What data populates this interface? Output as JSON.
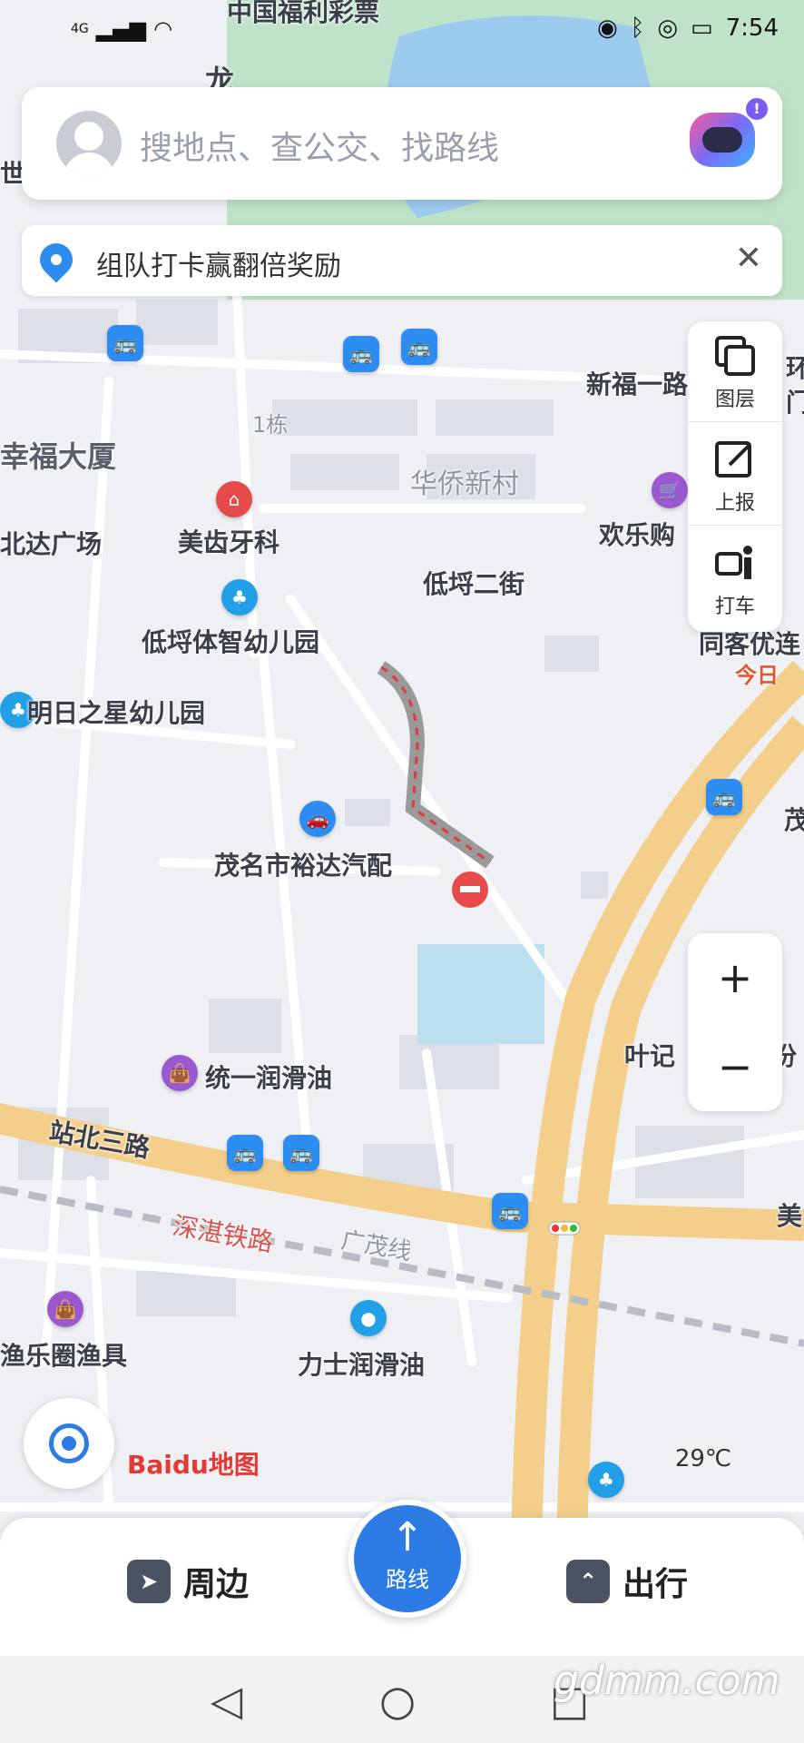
{
  "status": {
    "network": "4G",
    "time": "7:54"
  },
  "search": {
    "placeholder": "搜地点、查公交、找路线",
    "badge": "!"
  },
  "banner": {
    "text": "组队打卡赢翻倍奖励",
    "close": "✕"
  },
  "tools": {
    "layers": "图层",
    "report": "上报",
    "taxi": "打车"
  },
  "zoom": {
    "plus": "+",
    "minus": "−"
  },
  "map_labels": {
    "top1": "中国福利彩票",
    "long": "龙",
    "shi": "世",
    "xinfu": "新福一路",
    "huan": "环",
    "men": "门",
    "dong1": "1栋",
    "xingfu": "幸福大厦",
    "huaqiao": "华侨新村",
    "huanle": "欢乐购",
    "beida": "北达广场",
    "meichi": "美齿牙科",
    "dipo2": "低埒二街",
    "dipo_kid": "低埒体智幼儿园",
    "tongke": "同客优连",
    "jinri": "今日",
    "mingri": "明日之星幼儿园",
    "yuda": "茂名市裕达汽配",
    "mao": "茂",
    "yeji": "叶记",
    "fen": "份",
    "tongyi": "统一润滑油",
    "zhanbei": "站北三路",
    "shenzhan": "深湛铁路",
    "guangmao": "广茂线",
    "mei": "美",
    "yule": "渔乐圈渔具",
    "lishi": "力士润滑油"
  },
  "logo": "Baidu地图",
  "temperature": "29℃",
  "bottom": {
    "nearby": "周边",
    "route": "路线",
    "travel": "出行"
  },
  "watermark": "gdmm.com"
}
